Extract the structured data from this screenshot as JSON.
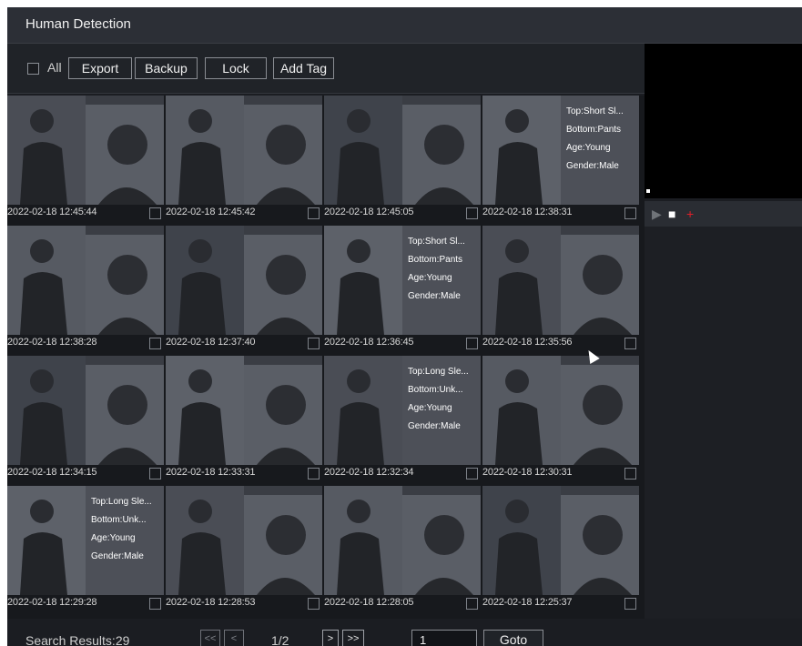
{
  "window": {
    "title": "Human Detection"
  },
  "toolbar": {
    "all_label": "All",
    "export_label": "Export",
    "backup_label": "Backup",
    "lock_label": "Lock",
    "add_tag_label": "Add Tag"
  },
  "results": [
    {
      "timestamp": "2022-02-18 12:45:44"
    },
    {
      "timestamp": "2022-02-18 12:45:42"
    },
    {
      "timestamp": "2022-02-18 12:45:05"
    },
    {
      "timestamp": "2022-02-18 12:38:31",
      "attributes": [
        "Top:Short Sl...",
        "Bottom:Pants",
        "Age:Young",
        "Gender:Male"
      ]
    },
    {
      "timestamp": "2022-02-18 12:38:28"
    },
    {
      "timestamp": "2022-02-18 12:37:40"
    },
    {
      "timestamp": "2022-02-18 12:36:45",
      "attributes": [
        "Top:Short Sl...",
        "Bottom:Pants",
        "Age:Young",
        "Gender:Male"
      ]
    },
    {
      "timestamp": "2022-02-18 12:35:56"
    },
    {
      "timestamp": "2022-02-18 12:34:15"
    },
    {
      "timestamp": "2022-02-18 12:33:31"
    },
    {
      "timestamp": "2022-02-18 12:32:34",
      "attributes": [
        "Top:Long Sle...",
        "Bottom:Unk...",
        "Age:Young",
        "Gender:Male"
      ]
    },
    {
      "timestamp": "2022-02-18 12:30:31"
    },
    {
      "timestamp": "2022-02-18 12:29:28",
      "attributes": [
        "Top:Long Sle...",
        "Bottom:Unk...",
        "Age:Young",
        "Gender:Male"
      ]
    },
    {
      "timestamp": "2022-02-18 12:28:53"
    },
    {
      "timestamp": "2022-02-18 12:28:05"
    },
    {
      "timestamp": "2022-02-18 12:25:37"
    }
  ],
  "playback": {
    "play_icon": "play-icon",
    "stop_icon": "stop-icon",
    "add_tag_icon": "add-tag-icon",
    "play_color": "#6f7378",
    "stop_color": "#ffffff",
    "tag_color": "#e0202a"
  },
  "pagination": {
    "search_results": "Search Results:29",
    "first_label": "<<",
    "prev_label": "<",
    "page_info": "1/2",
    "next_label": ">",
    "last_label": ">>",
    "goto_value": "1",
    "goto_label": "Goto"
  },
  "colors": {
    "background": "#1b1d22",
    "titlebar": "#2c2f36",
    "attr_panel": "#4d5058",
    "text": "#e8e8e8"
  }
}
